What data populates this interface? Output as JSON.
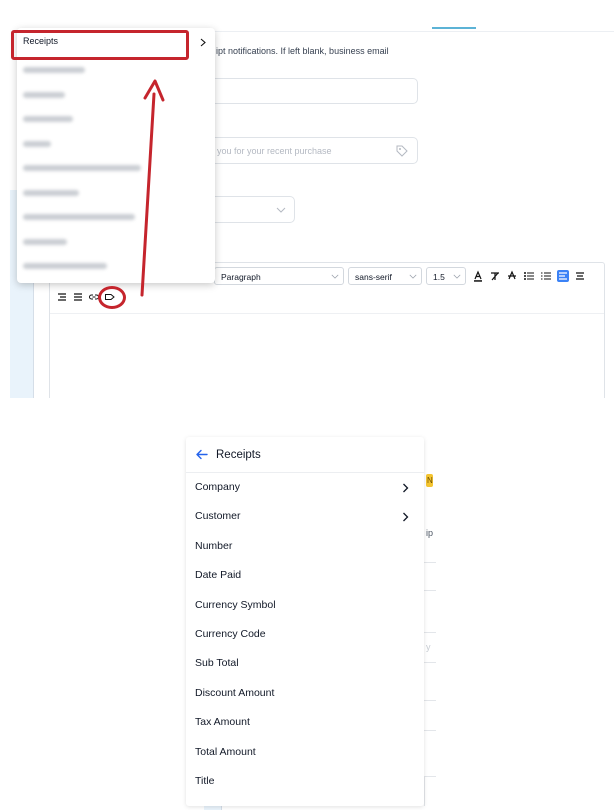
{
  "top": {
    "helper_text": "ipt notifications. If left blank, business email",
    "subject_placeholder": "you for your recent purchase",
    "dropdown": {
      "header": "Receipts"
    },
    "toolbar": {
      "paragraph": "Paragraph",
      "font": "sans-serif",
      "line_height": "1.5"
    }
  },
  "menu": {
    "back_title": "Receipts",
    "items": [
      {
        "label": "Company",
        "has_submenu": true
      },
      {
        "label": "Customer",
        "has_submenu": true
      },
      {
        "label": "Number",
        "has_submenu": false
      },
      {
        "label": "Date Paid",
        "has_submenu": false
      },
      {
        "label": "Currency Symbol",
        "has_submenu": false
      },
      {
        "label": "Currency Code",
        "has_submenu": false
      },
      {
        "label": "Sub Total",
        "has_submenu": false
      },
      {
        "label": "Discount Amount",
        "has_submenu": false
      },
      {
        "label": "Tax Amount",
        "has_submenu": false
      },
      {
        "label": "Total Amount",
        "has_submenu": false
      },
      {
        "label": "Title",
        "has_submenu": false
      }
    ]
  },
  "background": {
    "badge": "N",
    "fragment_1": "ip",
    "fragment_2": "y"
  },
  "colors": {
    "annotation_red": "#c5252d",
    "accent_blue": "#3b82f6",
    "badge_yellow": "#f4c430"
  }
}
